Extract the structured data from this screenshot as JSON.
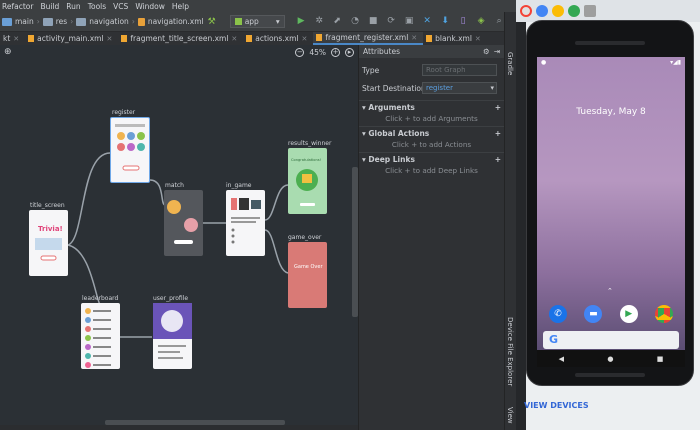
{
  "menu": [
    "Refactor",
    "Build",
    "Run",
    "Tools",
    "VCS",
    "Window",
    "Help"
  ],
  "breadcrumbs": [
    "main",
    "res",
    "navigation",
    "navigation.xml"
  ],
  "run_config": "app",
  "tabs": [
    {
      "label": "kt"
    },
    {
      "label": "activity_main.xml"
    },
    {
      "label": "fragment_title_screen.xml"
    },
    {
      "label": "actions.xml"
    },
    {
      "label": "fragment_register.xml",
      "active": true
    },
    {
      "label": "blank.xml"
    }
  ],
  "zoom": "45%",
  "attributes": {
    "header": "Attributes",
    "type_label": "Type",
    "type_value": "Root Graph",
    "start_label": "Start Destination",
    "start_value": "register",
    "sections": [
      {
        "title": "Arguments",
        "hint": "Click + to add Arguments"
      },
      {
        "title": "Global Actions",
        "hint": "Click + to add Actions"
      },
      {
        "title": "Deep Links",
        "hint": "Click + to add Deep Links"
      }
    ]
  },
  "destinations": {
    "register": "register",
    "title_screen": "title_screen",
    "match": "match",
    "in_game": "in_game",
    "results_winner": "results_winner",
    "game_over": "game_over",
    "leaderboard": "leaderboard",
    "user_profile": "user_profile"
  },
  "thumb_text": {
    "trivia": "Trivia!",
    "congrats": "Congratulations!",
    "game_over": "Game Over"
  },
  "side_tools": [
    "Gradle",
    "Device File Explorer",
    "View"
  ],
  "phone": {
    "date": "Tuesday, May 8",
    "view_devices": "VIEW DEVICES"
  },
  "colors": {
    "accent": "#4a88c7",
    "results_winner": "#a9dcb0",
    "game_over": "#d97a76",
    "user_profile": "#6a54b8"
  }
}
